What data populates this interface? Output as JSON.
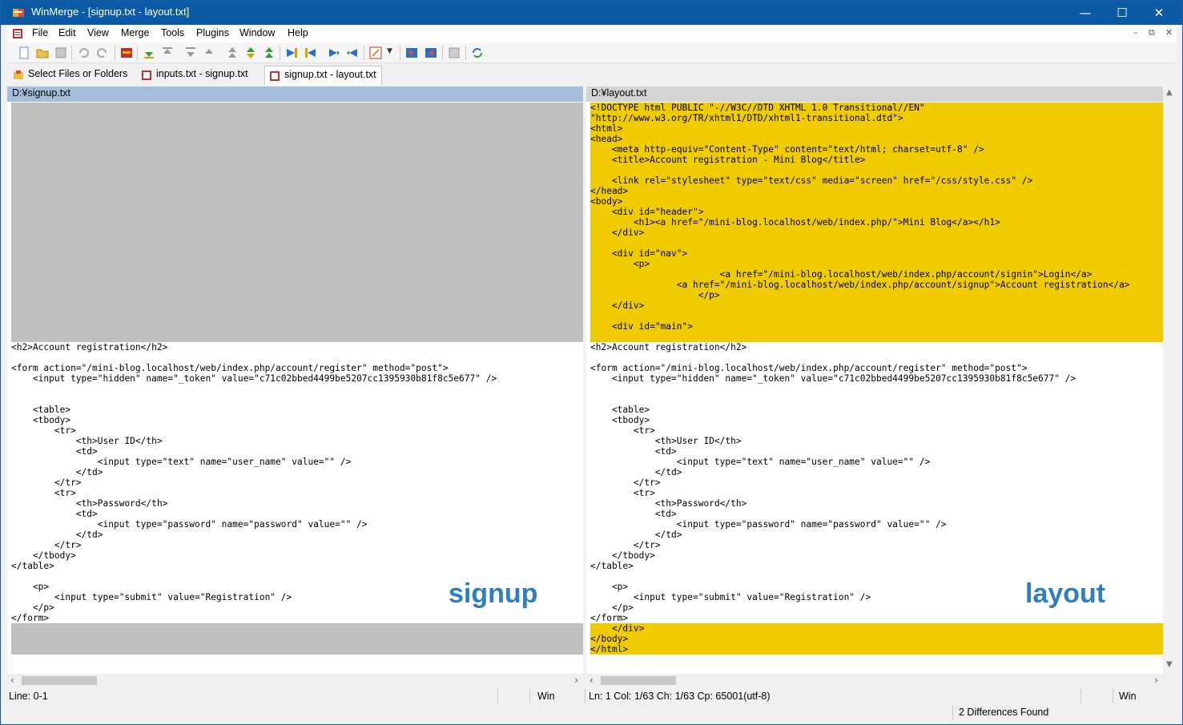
{
  "window": {
    "title": "WinMerge - [signup.txt - layout.txt]"
  },
  "menu": [
    "File",
    "Edit",
    "View",
    "Merge",
    "Tools",
    "Plugins",
    "Window",
    "Help"
  ],
  "toolbar": {
    "icons": [
      "new-icon",
      "open-icon",
      "save-icon",
      "undo-icon",
      "redo-icon",
      "options-icon",
      "next-diff-icon",
      "prev-diff-icon",
      "first-diff-icon",
      "current-diff-icon",
      "last-diff-icon",
      "all-diffs-icon",
      "copy-right-icon",
      "copy-left-icon",
      "copy-right-advance-icon",
      "copy-left-advance-icon",
      "tools-icon",
      "dropdown-arrow-icon",
      "open-conflict-icon",
      "compare-icon",
      "preview-icon",
      "refresh-icon"
    ]
  },
  "tabs": [
    {
      "label": "Select Files or Folders",
      "icon": "folder-select-icon"
    },
    {
      "label": "inputs.txt - signup.txt",
      "icon": "compare-doc-icon"
    },
    {
      "label": "signup.txt - layout.txt",
      "icon": "compare-doc-icon",
      "active": true
    }
  ],
  "left_pane": {
    "path": "D:¥signup.txt",
    "watermark": "signup",
    "lines": [
      {
        "t": "",
        "s": "gray"
      },
      {
        "t": "",
        "s": "gray"
      },
      {
        "t": "",
        "s": "gray"
      },
      {
        "t": "",
        "s": "gray"
      },
      {
        "t": "",
        "s": "gray"
      },
      {
        "t": "",
        "s": "gray"
      },
      {
        "t": "",
        "s": "gray"
      },
      {
        "t": "",
        "s": "gray"
      },
      {
        "t": "",
        "s": "gray"
      },
      {
        "t": "",
        "s": "gray"
      },
      {
        "t": "",
        "s": "gray"
      },
      {
        "t": "",
        "s": "gray"
      },
      {
        "t": "",
        "s": "gray"
      },
      {
        "t": "",
        "s": "gray"
      },
      {
        "t": "",
        "s": "gray"
      },
      {
        "t": "",
        "s": "gray"
      },
      {
        "t": "",
        "s": "gray"
      },
      {
        "t": "",
        "s": "gray"
      },
      {
        "t": "",
        "s": "gray"
      },
      {
        "t": "",
        "s": "gray"
      },
      {
        "t": "",
        "s": "gray"
      },
      {
        "t": "",
        "s": "gray"
      },
      {
        "t": "",
        "s": "gray"
      },
      {
        "t": "<h2>Account registration</h2>",
        "s": ""
      },
      {
        "t": "",
        "s": ""
      },
      {
        "t": "<form action=\"/mini-blog.localhost/web/index.php/account/register\" method=\"post\">",
        "s": ""
      },
      {
        "t": "    <input type=\"hidden\" name=\"_token\" value=\"c71c02bbed4499be5207cc1395930b81f8c5e677\" />",
        "s": ""
      },
      {
        "t": "",
        "s": ""
      },
      {
        "t": "",
        "s": ""
      },
      {
        "t": "    <table>",
        "s": ""
      },
      {
        "t": "    <tbody>",
        "s": ""
      },
      {
        "t": "        <tr>",
        "s": ""
      },
      {
        "t": "            <th>User ID</th>",
        "s": ""
      },
      {
        "t": "            <td>",
        "s": ""
      },
      {
        "t": "                <input type=\"text\" name=\"user_name\" value=\"\" />",
        "s": ""
      },
      {
        "t": "            </td>",
        "s": ""
      },
      {
        "t": "        </tr>",
        "s": ""
      },
      {
        "t": "        <tr>",
        "s": ""
      },
      {
        "t": "            <th>Password</th>",
        "s": ""
      },
      {
        "t": "            <td>",
        "s": ""
      },
      {
        "t": "                <input type=\"password\" name=\"password\" value=\"\" />",
        "s": ""
      },
      {
        "t": "            </td>",
        "s": ""
      },
      {
        "t": "        </tr>",
        "s": ""
      },
      {
        "t": "    </tbody>",
        "s": ""
      },
      {
        "t": "</table>",
        "s": ""
      },
      {
        "t": "",
        "s": ""
      },
      {
        "t": "    <p>",
        "s": ""
      },
      {
        "t": "        <input type=\"submit\" value=\"Registration\" />",
        "s": ""
      },
      {
        "t": "    </p>",
        "s": ""
      },
      {
        "t": "</form>",
        "s": ""
      },
      {
        "t": "",
        "s": "gray"
      },
      {
        "t": "",
        "s": "gray"
      },
      {
        "t": "",
        "s": "gray"
      }
    ]
  },
  "right_pane": {
    "path": "D:¥layout.txt",
    "watermark": "layout",
    "lines": [
      {
        "t": "<!DOCTYPE html PUBLIC \"-//W3C//DTD XHTML 1.0 Transitional//EN\"",
        "s": "yellow"
      },
      {
        "t": "\"http://www.w3.org/TR/xhtml1/DTD/xhtml1-transitional.dtd\">",
        "s": "yellow"
      },
      {
        "t": "<html>",
        "s": "yellow"
      },
      {
        "t": "<head>",
        "s": "yellow"
      },
      {
        "t": "    <meta http-equiv=\"Content-Type\" content=\"text/html; charset=utf-8\" />",
        "s": "yellow"
      },
      {
        "t": "    <title>Account registration - Mini Blog</title>",
        "s": "yellow"
      },
      {
        "t": "",
        "s": "yellow"
      },
      {
        "t": "    <link rel=\"stylesheet\" type=\"text/css\" media=\"screen\" href=\"/css/style.css\" />",
        "s": "yellow"
      },
      {
        "t": "</head>",
        "s": "yellow"
      },
      {
        "t": "<body>",
        "s": "yellow"
      },
      {
        "t": "    <div id=\"header\">",
        "s": "yellow"
      },
      {
        "t": "        <h1><a href=\"/mini-blog.localhost/web/index.php/\">Mini Blog</a></h1>",
        "s": "yellow"
      },
      {
        "t": "    </div>",
        "s": "yellow"
      },
      {
        "t": "",
        "s": "yellow"
      },
      {
        "t": "    <div id=\"nav\">",
        "s": "yellow"
      },
      {
        "t": "        <p>",
        "s": "yellow"
      },
      {
        "t": "                        <a href=\"/mini-blog.localhost/web/index.php/account/signin\">Login</a>",
        "s": "yellow"
      },
      {
        "t": "                <a href=\"/mini-blog.localhost/web/index.php/account/signup\">Account registration</a>",
        "s": "yellow"
      },
      {
        "t": "                    </p>",
        "s": "yellow"
      },
      {
        "t": "    </div>",
        "s": "yellow"
      },
      {
        "t": "",
        "s": "yellow"
      },
      {
        "t": "    <div id=\"main\">",
        "s": "yellow"
      },
      {
        "t": "",
        "s": "yellow"
      },
      {
        "t": "<h2>Account registration</h2>",
        "s": ""
      },
      {
        "t": "",
        "s": ""
      },
      {
        "t": "<form action=\"/mini-blog.localhost/web/index.php/account/register\" method=\"post\">",
        "s": ""
      },
      {
        "t": "    <input type=\"hidden\" name=\"_token\" value=\"c71c02bbed4499be5207cc1395930b81f8c5e677\" />",
        "s": ""
      },
      {
        "t": "",
        "s": ""
      },
      {
        "t": "",
        "s": ""
      },
      {
        "t": "    <table>",
        "s": ""
      },
      {
        "t": "    <tbody>",
        "s": ""
      },
      {
        "t": "        <tr>",
        "s": ""
      },
      {
        "t": "            <th>User ID</th>",
        "s": ""
      },
      {
        "t": "            <td>",
        "s": ""
      },
      {
        "t": "                <input type=\"text\" name=\"user_name\" value=\"\" />",
        "s": ""
      },
      {
        "t": "            </td>",
        "s": ""
      },
      {
        "t": "        </tr>",
        "s": ""
      },
      {
        "t": "        <tr>",
        "s": ""
      },
      {
        "t": "            <th>Password</th>",
        "s": ""
      },
      {
        "t": "            <td>",
        "s": ""
      },
      {
        "t": "                <input type=\"password\" name=\"password\" value=\"\" />",
        "s": ""
      },
      {
        "t": "            </td>",
        "s": ""
      },
      {
        "t": "        </tr>",
        "s": ""
      },
      {
        "t": "    </tbody>",
        "s": ""
      },
      {
        "t": "</table>",
        "s": ""
      },
      {
        "t": "",
        "s": ""
      },
      {
        "t": "    <p>",
        "s": ""
      },
      {
        "t": "        <input type=\"submit\" value=\"Registration\" />",
        "s": ""
      },
      {
        "t": "    </p>",
        "s": ""
      },
      {
        "t": "</form>",
        "s": ""
      },
      {
        "t": "    </div>",
        "s": "yellow"
      },
      {
        "t": "</body>",
        "s": "yellow"
      },
      {
        "t": "</html>",
        "s": "yellow"
      }
    ]
  },
  "status": {
    "left_line": "Line: 0-1",
    "left_eol": "Win",
    "right_pos": "Ln: 1  Col: 1/63  Ch: 1/63  Cp: 65001(utf-8)",
    "right_eol": "Win",
    "differences": "2 Differences Found"
  },
  "colors": {
    "title_bar": "#0b5aa6",
    "left_header": "#a6bfd9",
    "missing_lines": "#c0c0c0",
    "diff_lines": "#efcb00",
    "watermark": "#2f7ec1"
  }
}
